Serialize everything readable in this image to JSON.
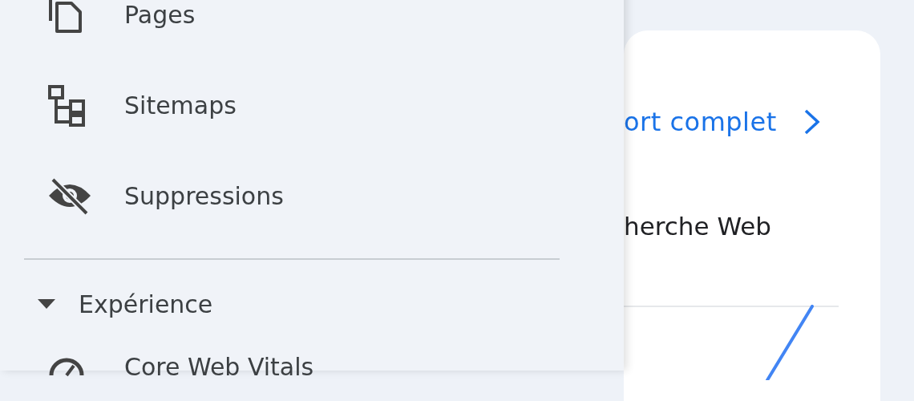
{
  "sidebar": {
    "items": [
      {
        "label": "Pages"
      },
      {
        "label": "Sitemaps"
      },
      {
        "label": "Suppressions"
      }
    ],
    "section": {
      "label": "Expérience",
      "expanded": true,
      "items": [
        {
          "label": "Core Web Vitals"
        }
      ]
    }
  },
  "card": {
    "link": "ort complet",
    "subtitle": "herche Web"
  }
}
